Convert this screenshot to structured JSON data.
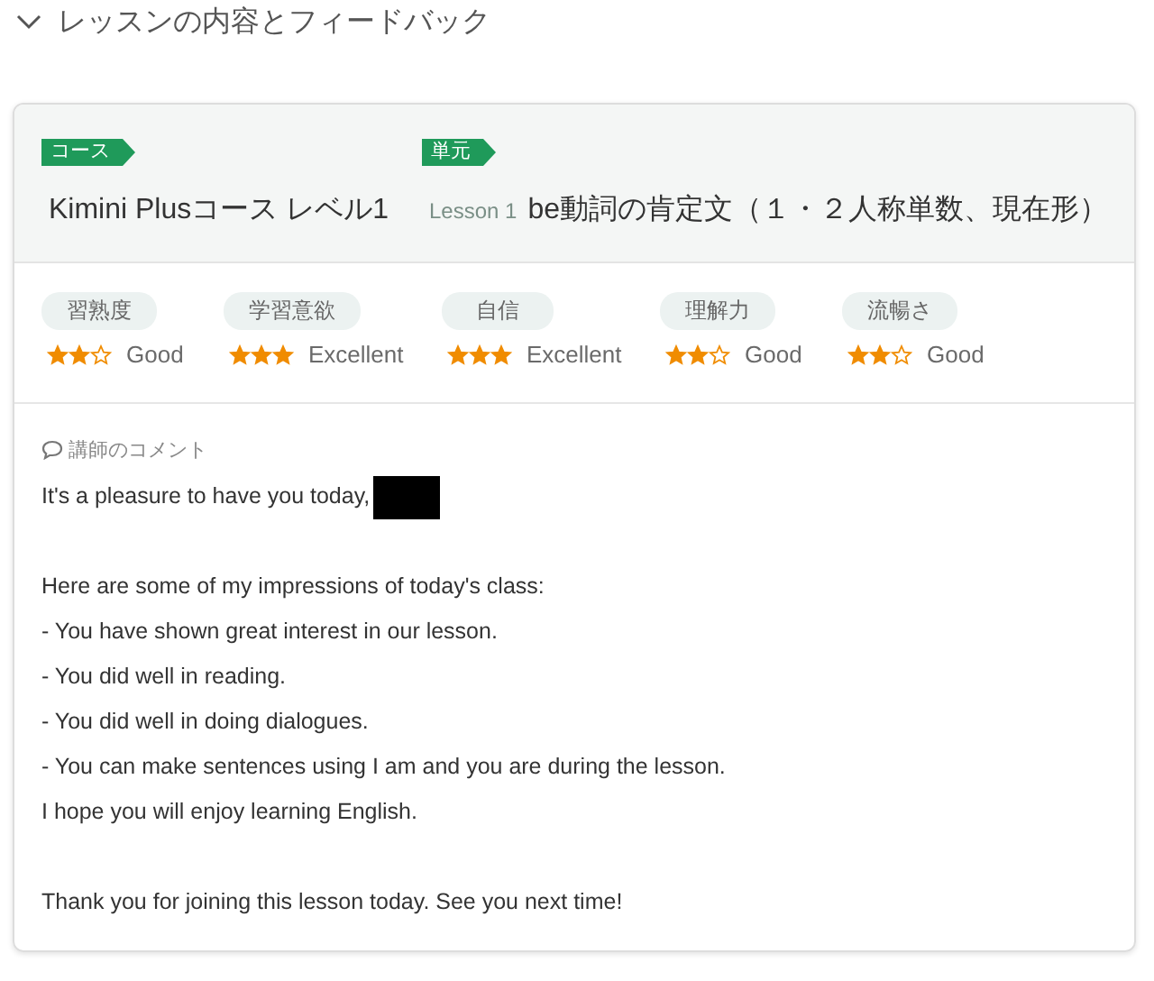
{
  "section": {
    "title": "レッスンの内容とフィードバック",
    "expanded": true
  },
  "course": {
    "tag": "コース",
    "name": "Kimini Plusコース レベル1"
  },
  "unit": {
    "tag": "単元",
    "lesson": "Lesson 1",
    "name": "be動詞の肯定文（１・２人称単数、現在形）"
  },
  "ratings": [
    {
      "label": "習熟度",
      "stars": 2,
      "grade": "Good"
    },
    {
      "label": "学習意欲",
      "stars": 3,
      "grade": "Excellent"
    },
    {
      "label": "自信",
      "stars": 3,
      "grade": "Excellent"
    },
    {
      "label": "理解力",
      "stars": 2,
      "grade": "Good"
    },
    {
      "label": "流暢さ",
      "stars": 2,
      "grade": "Good"
    }
  ],
  "comment": {
    "label": "講師のコメント",
    "greeting": "It's a pleasure to have you today,",
    "name_redacted": true,
    "paragraphs": [
      [
        "Here are some of my impressions of today's class:",
        "- You have shown great interest in our lesson.",
        "- You did well in reading.",
        "- You did well in doing dialogues.",
        "- You can make sentences using I am and you are during the lesson.",
        "I hope you will enjoy learning English."
      ],
      [
        "Thank you for joining this lesson today. See you next time!"
      ]
    ]
  }
}
